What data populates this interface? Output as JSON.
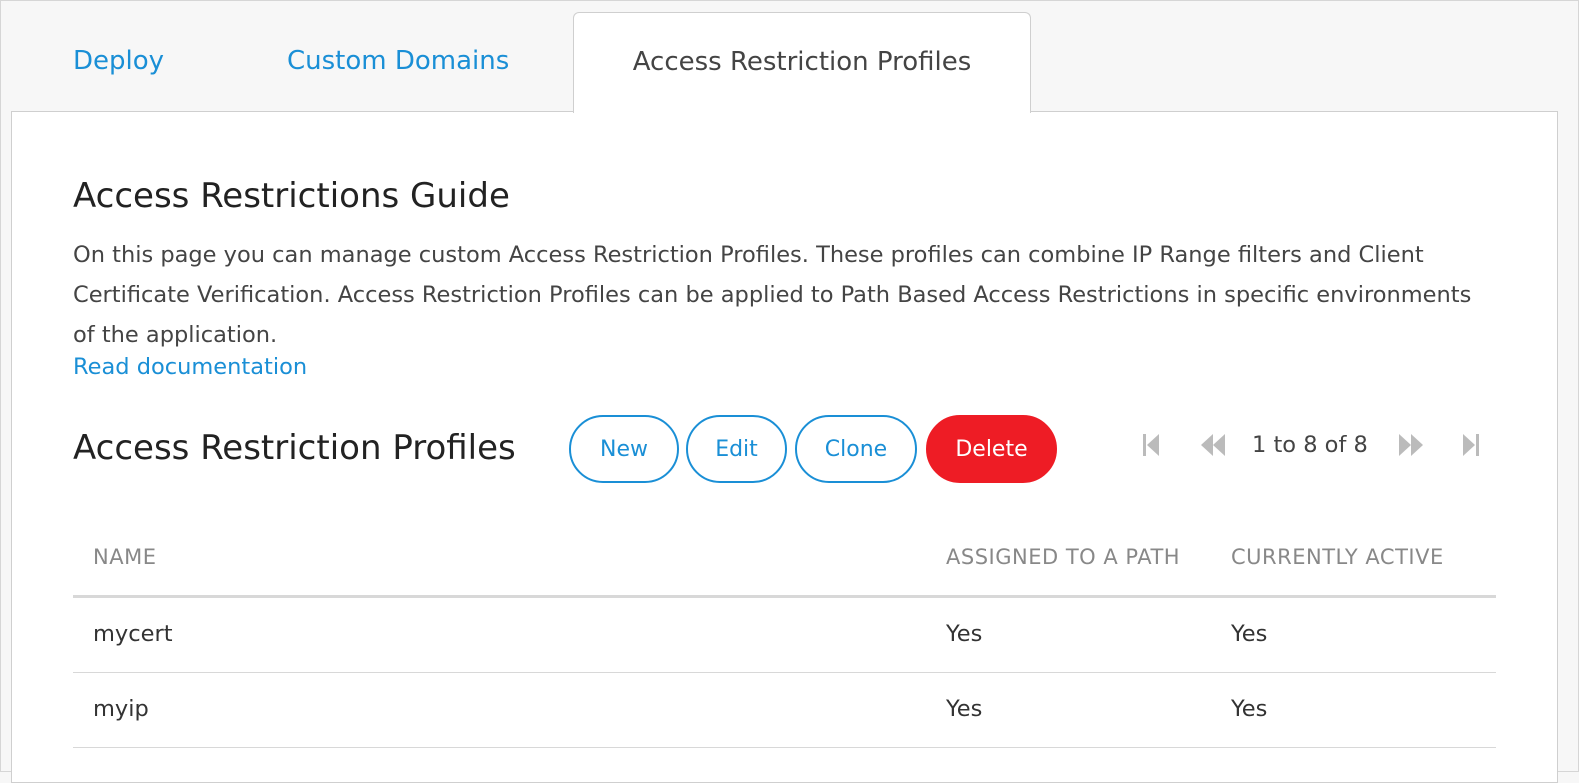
{
  "tabs": {
    "deploy": "Deploy",
    "custom_domains": "Custom Domains",
    "access_restriction_profiles": "Access Restriction Profiles"
  },
  "guide": {
    "title": "Access Restrictions Guide",
    "text": "On this page you can manage custom Access Restriction Profiles. These profiles can combine IP Range filters and Client Certificate Verification. Access Restriction Profiles can be applied to Path Based Access Restrictions in specific environments of the application.",
    "link": "Read documentation"
  },
  "profiles": {
    "title": "Access Restriction Profiles",
    "buttons": {
      "new": "New",
      "edit": "Edit",
      "clone": "Clone",
      "delete": "Delete"
    },
    "pager_text": "1 to 8 of 8",
    "columns": [
      "NAME",
      "ASSIGNED TO A PATH",
      "CURRENTLY ACTIVE"
    ],
    "rows": [
      [
        "mycert",
        "Yes",
        "Yes"
      ],
      [
        "myip",
        "Yes",
        "Yes"
      ]
    ]
  },
  "icons": {
    "first": "first-page-icon",
    "prev": "previous-page-icon",
    "next": "next-page-icon",
    "last": "last-page-icon"
  },
  "colors": {
    "accent": "#1a8fd6",
    "danger": "#ee1c25",
    "pager_disabled": "#bbbbbb"
  }
}
